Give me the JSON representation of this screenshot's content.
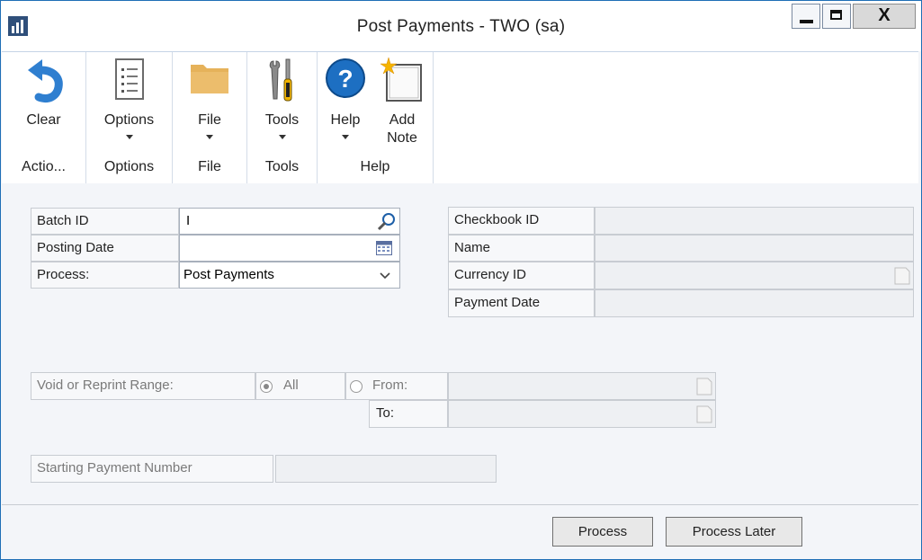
{
  "window": {
    "title": "Post Payments  -  TWO (sa)",
    "close_label": "X"
  },
  "ribbon": {
    "groups": [
      {
        "caption": "Actio...",
        "buttons": [
          {
            "label": "Clear",
            "icon": "undo-icon"
          }
        ]
      },
      {
        "caption": "Options",
        "buttons": [
          {
            "label": "Options",
            "icon": "options-list-icon"
          }
        ]
      },
      {
        "caption": "File",
        "buttons": [
          {
            "label": "File",
            "icon": "folder-icon"
          }
        ]
      },
      {
        "caption": "Tools",
        "buttons": [
          {
            "label": "Tools",
            "icon": "tools-icon"
          }
        ]
      },
      {
        "caption": "Help",
        "buttons": [
          {
            "label": "Help",
            "icon": "help-icon"
          },
          {
            "label": "Add\nNote",
            "icon": "add-note-icon"
          }
        ]
      }
    ]
  },
  "form": {
    "batch_id_label": "Batch ID",
    "batch_id_value": "I",
    "posting_date_label": "Posting Date",
    "posting_date_value": "",
    "process_label": "Process:",
    "process_value": "Post Payments",
    "checkbook_id_label": "Checkbook ID",
    "name_label": "Name",
    "currency_id_label": "Currency ID",
    "payment_date_label": "Payment Date",
    "void_range_label": "Void or Reprint Range:",
    "radio_all_label": "All",
    "radio_from_label": "From:",
    "to_label": "To:",
    "starting_payment_label": "Starting Payment Number"
  },
  "buttons": {
    "process_label": "Process",
    "process_later_label": "Process Later"
  },
  "colors": {
    "window_border": "#1f6fb6",
    "help_blue": "#1d6fc2",
    "folder": "#e8b45c"
  }
}
